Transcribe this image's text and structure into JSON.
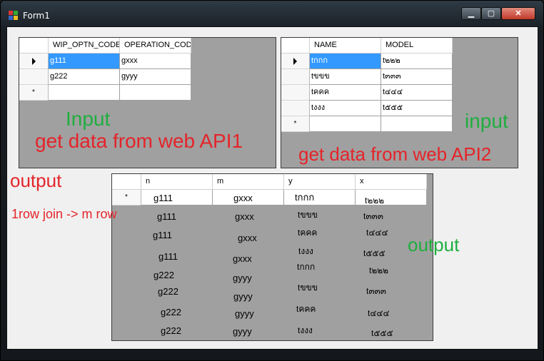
{
  "window": {
    "title": "Form1"
  },
  "title_controls": {
    "minimize": "▁",
    "maximize": "▢",
    "close": "✕"
  },
  "grid1": {
    "columns": [
      "WIP_OPTN_CODE",
      "OPERATION_COD"
    ],
    "rows": [
      [
        "g111",
        "gxxx"
      ],
      [
        "g222",
        "gyyy"
      ]
    ],
    "new_row_marker": "*"
  },
  "grid2": {
    "columns": [
      "NAME",
      "MODEL"
    ],
    "rows": [
      [
        "tกกก",
        "t๒๒๒"
      ],
      [
        "tขขข",
        "t๓๓๓"
      ],
      [
        "tคคค",
        "t๔๔๔"
      ],
      [
        "tงงง",
        "t๕๕๕"
      ]
    ],
    "new_row_marker": "*"
  },
  "grid3": {
    "columns": [
      "n",
      "m",
      "y",
      "x"
    ],
    "new_row_marker": "*",
    "first_row": [
      "g111",
      "gxxx",
      "tกกก",
      "t๒๒๒"
    ],
    "rows": [
      [
        "g111",
        "gxxx",
        "tขขข",
        "t๓๓๓"
      ],
      [
        "g111",
        "gxxx",
        "tคคค",
        "t๔๔๔"
      ],
      [
        "g111",
        "gxxx",
        "tงงง",
        "t๕๕๕"
      ],
      [
        "g222",
        "gyyy",
        "tกกก",
        "t๒๒๒"
      ],
      [
        "g222",
        "gyyy",
        "tขขข",
        "t๓๓๓"
      ],
      [
        "g222",
        "gyyy",
        "tคคค",
        "t๔๔๔"
      ],
      [
        "g222",
        "gyyy",
        "tงงง",
        "t๕๕๕"
      ]
    ]
  },
  "annotations": {
    "input1": "Input",
    "api1": "get data from web API1",
    "input2": "input",
    "api2": "get data from web API2",
    "output_left": "output",
    "join_note": "1row join -> m row",
    "output_right": "output"
  },
  "colors": {
    "annotation_green": "#1fae3f",
    "annotation_red": "#e4242a",
    "selection": "#3399ff"
  }
}
